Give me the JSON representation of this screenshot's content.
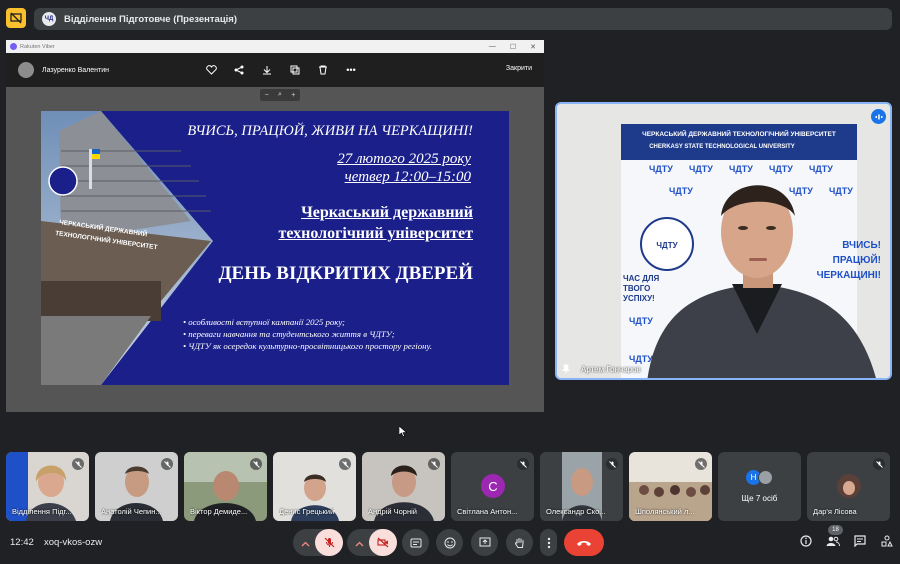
{
  "topbar": {
    "presentation_title": "Відділення Підготовче (Презентація)"
  },
  "viber": {
    "app_name": "Rakuten Viber",
    "sender_name": "Лазуренко Валентин",
    "close_label": "Закрити",
    "zoom_minus": "−",
    "zoom_plus": "+"
  },
  "slide": {
    "motto": "ВЧИСЬ, ПРАЦЮЙ, ЖИВИ НА ЧЕРКАЩИНІ!",
    "date": "27 лютого 2025 року",
    "time": "четвер 12:00–15:00",
    "university_line1": "Черкаський державний",
    "university_line2": "технологічний університет",
    "event": "ДЕНЬ ВІДКРИТИХ ДВЕРЕЙ",
    "bullets": [
      "• особливості вступної кампанії 2025 року;",
      "• переваги навчання та студентського життя в ЧДТУ;",
      "• ЧДТУ як осередок культурно-просвітницького простору регіону."
    ],
    "building_sign_1": "ЧЕРКАСЬКИЙ ДЕРЖАВНИЙ",
    "building_sign_2": "ТЕХНОЛОГІЧНИЙ УНІВЕРСИТЕТ"
  },
  "speaker": {
    "name": "Артем Гончаров",
    "banner_title_ua": "ЧЕРКАСЬКИЙ ДЕРЖАВНИЙ ТЕХНОЛОГІЧНИЙ УНІВЕРСИТЕТ",
    "banner_title_en": "CHERKASY STATE TECHNOLOGICAL UNIVERSITY",
    "banner_logo_text": "ЧДТУ",
    "banner_slogan_left": "ЧАС ДЛЯ ТВОГО УСПІХУ!",
    "banner_slogan_right": "ВЧИСЬ! ПРАЦЮЙ! ЧЕРКАЩИНІ!"
  },
  "participants": [
    {
      "name": "Відділення Підг..."
    },
    {
      "name": "Анатолій Чепин..."
    },
    {
      "name": "Віктор Демиде..."
    },
    {
      "name": "Денис Грецький"
    },
    {
      "name": "Андрій Чорній"
    },
    {
      "name": "Світлана Антон...",
      "initial": "С"
    },
    {
      "name": "Олександр Ско..."
    },
    {
      "name": "Шполянський л..."
    },
    {
      "name": "Ще 7 осіб",
      "initial": "Н"
    },
    {
      "name": "Дар'я Лісова"
    }
  ],
  "bottombar": {
    "clock": "12:42",
    "meeting_code": "xoq-vkos-ozw",
    "participant_count": "18"
  },
  "colors": {
    "slide_bg": "#1a1f8a",
    "leave": "#ea4335",
    "speaking": "#8ab4f8"
  }
}
